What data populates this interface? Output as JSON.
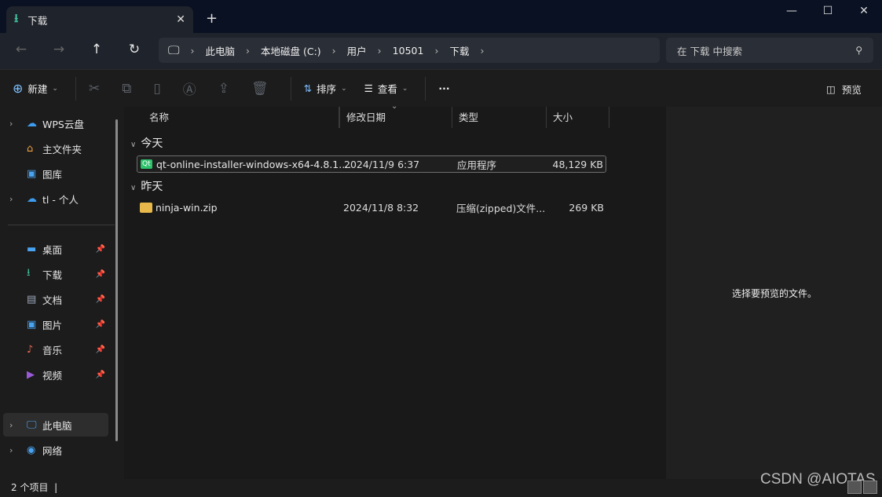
{
  "window": {
    "tab_title": "下载",
    "new_tab": "+",
    "close_tab": "✕",
    "minimize": "—",
    "maximize": "☐",
    "close": "✕"
  },
  "nav": {
    "back": "←",
    "forward": "→",
    "up": "↑",
    "refresh": "↻",
    "breadcrumb": [
      "此电脑",
      "本地磁盘 (C:)",
      "用户",
      "10501",
      "下载"
    ],
    "search_placeholder": "在 下载 中搜索"
  },
  "toolbar": {
    "new": "新建",
    "sort": "排序",
    "view": "查看",
    "more": "···",
    "preview": "预览"
  },
  "sidebar": {
    "items": [
      {
        "label": "WPS云盘",
        "icon": "☁",
        "color": "#3d9bf0",
        "expand": true
      },
      {
        "label": "主文件夹",
        "icon": "⌂",
        "color": "#f0a040",
        "expand": false
      },
      {
        "label": "图库",
        "icon": "▣",
        "color": "#4aa3f0",
        "expand": false
      },
      {
        "label": "tl - 个人",
        "icon": "☁",
        "color": "#3d9bf0",
        "expand": true
      }
    ],
    "pinned": [
      {
        "label": "桌面",
        "icon": "▬",
        "color": "#4aa3f0"
      },
      {
        "label": "下载",
        "icon": "⭳",
        "color": "#3fbf9a"
      },
      {
        "label": "文档",
        "icon": "▤",
        "color": "#9aa6b8"
      },
      {
        "label": "图片",
        "icon": "▣",
        "color": "#4aa3f0"
      },
      {
        "label": "音乐",
        "icon": "♪",
        "color": "#e86a50"
      },
      {
        "label": "视频",
        "icon": "▶",
        "color": "#9a5ad8"
      }
    ],
    "bottom": [
      {
        "label": "此电脑",
        "icon": "🖥",
        "color": "#4aa3f0"
      },
      {
        "label": "网络",
        "icon": "◉",
        "color": "#4aa3f0"
      }
    ]
  },
  "columns": [
    "名称",
    "修改日期",
    "类型",
    "大小"
  ],
  "groups": [
    {
      "label": "今天",
      "files": [
        {
          "name": "qt-online-installer-windows-x64-4.8.1....",
          "date": "2024/11/9 6:37",
          "type": "应用程序",
          "size": "48,129 KB",
          "icon": "Qt"
        }
      ]
    },
    {
      "label": "昨天",
      "files": [
        {
          "name": "ninja-win.zip",
          "date": "2024/11/8 8:32",
          "type": "压缩(zipped)文件...",
          "size": "269 KB",
          "icon": "zip"
        }
      ]
    }
  ],
  "preview": {
    "empty_text": "选择要预览的文件。"
  },
  "status": {
    "count": "2 个项目",
    "sep": "|"
  },
  "watermark": "CSDN @AIOTAS"
}
